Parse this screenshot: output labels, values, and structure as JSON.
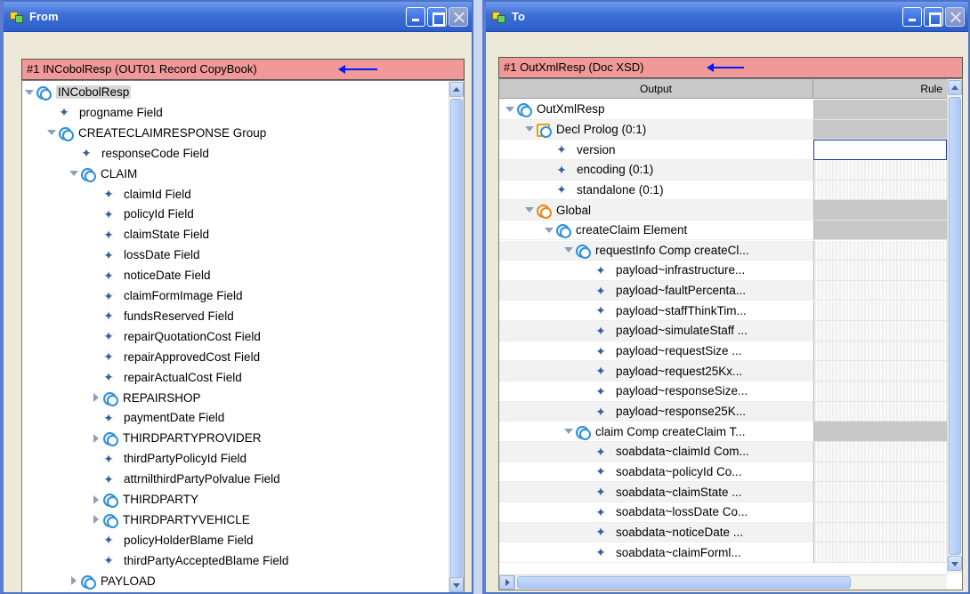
{
  "from": {
    "title": "From",
    "header": "#1 INCobolResp (OUT01 Record CopyBook)",
    "tree": [
      {
        "label": "INCobolResp",
        "type": "group",
        "toggle": "open",
        "level": 0,
        "selected": true
      },
      {
        "label": "progname Field",
        "type": "field",
        "level": 1
      },
      {
        "label": "CREATECLAIMRESPONSE Group",
        "type": "group",
        "toggle": "open",
        "level": 1
      },
      {
        "label": "responseCode Field",
        "type": "field",
        "level": 2
      },
      {
        "label": "CLAIM",
        "type": "group",
        "toggle": "open",
        "level": 2
      },
      {
        "label": "claimId Field",
        "type": "field",
        "level": 3
      },
      {
        "label": "policyId Field",
        "type": "field",
        "level": 3
      },
      {
        "label": "claimState Field",
        "type": "field",
        "level": 3
      },
      {
        "label": "lossDate Field",
        "type": "field",
        "level": 3
      },
      {
        "label": "noticeDate Field",
        "type": "field",
        "level": 3
      },
      {
        "label": "claimFormImage Field",
        "type": "field",
        "level": 3
      },
      {
        "label": "fundsReserved Field",
        "type": "field",
        "level": 3
      },
      {
        "label": "repairQuotationCost Field",
        "type": "field",
        "level": 3
      },
      {
        "label": "repairApprovedCost Field",
        "type": "field",
        "level": 3
      },
      {
        "label": "repairActualCost Field",
        "type": "field",
        "level": 3
      },
      {
        "label": "REPAIRSHOP",
        "type": "group",
        "toggle": "closed",
        "level": 3
      },
      {
        "label": "paymentDate Field",
        "type": "field",
        "level": 3
      },
      {
        "label": "THIRDPARTYPROVIDER",
        "type": "group",
        "toggle": "closed",
        "level": 3
      },
      {
        "label": "thirdPartyPolicyId Field",
        "type": "field",
        "level": 3
      },
      {
        "label": "attrnilthirdPartyPolvalue Field",
        "type": "field",
        "level": 3
      },
      {
        "label": "THIRDPARTY",
        "type": "group",
        "toggle": "closed",
        "level": 3
      },
      {
        "label": "THIRDPARTYVEHICLE",
        "type": "group",
        "toggle": "closed",
        "level": 3
      },
      {
        "label": "policyHolderBlame Field",
        "type": "field",
        "level": 3
      },
      {
        "label": "thirdPartyAcceptedBlame Field",
        "type": "field",
        "level": 3
      },
      {
        "label": "PAYLOAD",
        "type": "group",
        "toggle": "closed",
        "level": 2
      }
    ]
  },
  "to": {
    "title": "To",
    "header": "#1 OutXmlResp (Doc XSD)",
    "columns": {
      "output": "Output",
      "rule": "Rule"
    },
    "tree": [
      {
        "label": "OutXmlResp",
        "type": "group",
        "toggle": "open",
        "level": 0,
        "rule": "g"
      },
      {
        "label": "Decl Prolog (0:1)",
        "type": "decl",
        "toggle": "open",
        "level": 1,
        "rule": "g"
      },
      {
        "label": "version",
        "type": "field",
        "level": 2,
        "rule": "e"
      },
      {
        "label": "encoding (0:1)",
        "type": "field",
        "level": 2,
        "rule": "s"
      },
      {
        "label": "standalone (0:1)",
        "type": "field",
        "level": 2,
        "rule": "s"
      },
      {
        "label": "Global",
        "type": "glob",
        "toggle": "open",
        "level": 1,
        "rule": "g"
      },
      {
        "label": "createClaim Element",
        "type": "group",
        "toggle": "open",
        "level": 2,
        "rule": "g"
      },
      {
        "label": "requestInfo Comp createCl...",
        "type": "group",
        "toggle": "open",
        "level": 3,
        "rule": "s"
      },
      {
        "label": "payload~infrastructure...",
        "type": "field",
        "level": 4,
        "rule": "s"
      },
      {
        "label": "payload~faultPercenta...",
        "type": "field",
        "level": 4,
        "rule": "s"
      },
      {
        "label": "payload~staffThinkTim...",
        "type": "field",
        "level": 4,
        "rule": "s"
      },
      {
        "label": "payload~simulateStaff ...",
        "type": "field",
        "level": 4,
        "rule": "s"
      },
      {
        "label": "payload~requestSize ...",
        "type": "field",
        "level": 4,
        "rule": "s"
      },
      {
        "label": "payload~request25Kx...",
        "type": "field",
        "level": 4,
        "rule": "s"
      },
      {
        "label": "payload~responseSize...",
        "type": "field",
        "level": 4,
        "rule": "s"
      },
      {
        "label": "payload~response25K...",
        "type": "field",
        "level": 4,
        "rule": "s"
      },
      {
        "label": "claim Comp createClaim T...",
        "type": "group",
        "toggle": "open",
        "level": 3,
        "rule": "g"
      },
      {
        "label": "soabdata~claimId Com...",
        "type": "field",
        "level": 4,
        "rule": "s"
      },
      {
        "label": "soabdata~policyId Co...",
        "type": "field",
        "level": 4,
        "rule": "s"
      },
      {
        "label": "soabdata~claimState ...",
        "type": "field",
        "level": 4,
        "rule": "s"
      },
      {
        "label": "soabdata~lossDate Co...",
        "type": "field",
        "level": 4,
        "rule": "s"
      },
      {
        "label": "soabdata~noticeDate ...",
        "type": "field",
        "level": 4,
        "rule": "s"
      },
      {
        "label": "soabdata~claimForml...",
        "type": "field",
        "level": 4,
        "rule": "s"
      }
    ]
  }
}
